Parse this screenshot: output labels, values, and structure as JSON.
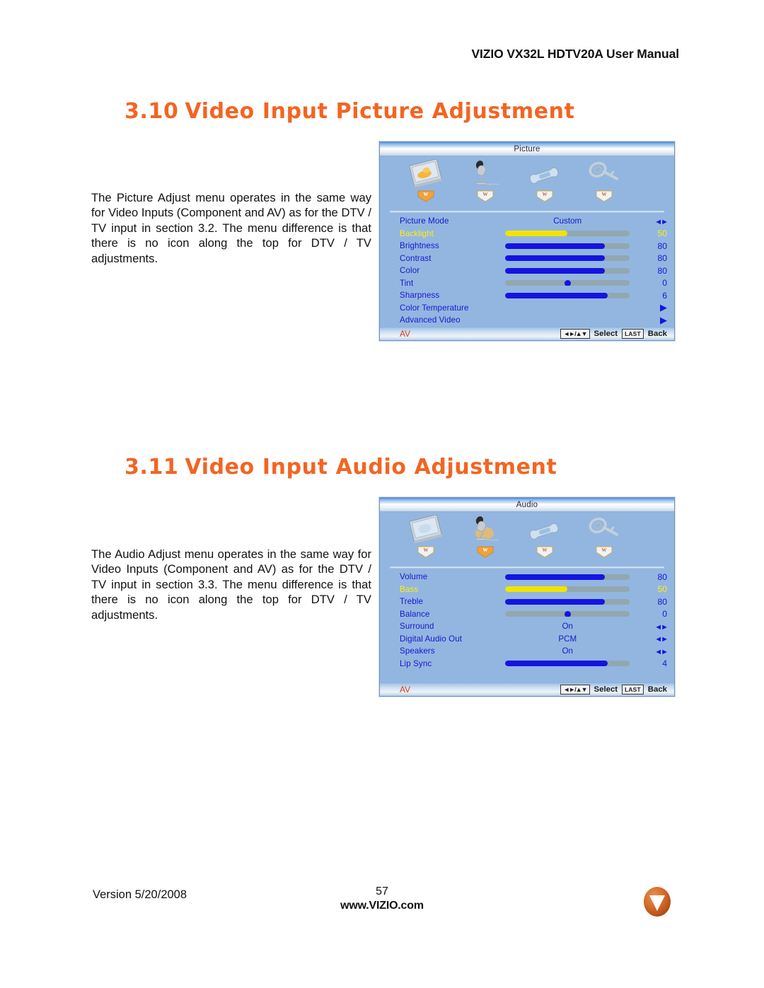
{
  "document": {
    "running_header": "VIZIO VX32L HDTV20A User Manual",
    "footer": {
      "version": "Version 5/20/2008",
      "page_number": "57",
      "website": "www.VIZIO.com",
      "logo_letter": "V",
      "logo_color": "#d4692a"
    }
  },
  "sections": [
    {
      "number": "3.10",
      "title": "Video Input Picture Adjustment",
      "body": "The Picture Adjust menu operates in the same way for Video Inputs (Component and AV) as for the DTV / TV input in section 3.2.  The menu difference is that there is no icon along the top for DTV / TV adjustments."
    },
    {
      "number": "3.11",
      "title": "Video Input Audio Adjustment",
      "body": "The Audio Adjust menu operates in the same way for Video Inputs (Component and AV) as for the DTV / TV input in section 3.3.  The menu difference is that there is no icon along the top for DTV / TV adjustments."
    }
  ],
  "osd_picture": {
    "title": "Picture",
    "icons": [
      {
        "name": "picture-screen-icon",
        "label": "Picture",
        "selected": true
      },
      {
        "name": "microphone-audio-icon",
        "label": "Audio",
        "selected": false
      },
      {
        "name": "wrench-setup-icon",
        "label": "Setup",
        "selected": false
      },
      {
        "name": "key-parental-icon",
        "label": "Parental",
        "selected": false
      }
    ],
    "rows": [
      {
        "label": "Picture Mode",
        "type": "option",
        "value": "Custom",
        "control": "left-right-arrows"
      },
      {
        "label": "Backlight",
        "type": "slider",
        "value": "50",
        "percent": 50,
        "highlighted": true
      },
      {
        "label": "Brightness",
        "type": "slider",
        "value": "80",
        "percent": 80,
        "highlighted": false
      },
      {
        "label": "Contrast",
        "type": "slider",
        "value": "80",
        "percent": 80,
        "highlighted": false
      },
      {
        "label": "Color",
        "type": "slider",
        "value": "80",
        "percent": 80,
        "highlighted": false
      },
      {
        "label": "Tint",
        "type": "centered-slider",
        "value": "0",
        "percent": 50,
        "highlighted": false
      },
      {
        "label": "Sharpness",
        "type": "slider",
        "value": "6",
        "percent": 82,
        "highlighted": false
      },
      {
        "label": "Color Temperature",
        "type": "submenu",
        "value": "",
        "control": "right-arrow"
      },
      {
        "label": "Advanced Video",
        "type": "submenu",
        "value": "",
        "control": "right-arrow"
      }
    ],
    "footer": {
      "input_label": "AV",
      "nav_key": "◄►/▲▼",
      "select_label": "Select",
      "last_key": "LAST",
      "back_label": "Back"
    }
  },
  "osd_audio": {
    "title": "Audio",
    "icons": [
      {
        "name": "picture-screen-icon",
        "label": "Picture",
        "selected": false
      },
      {
        "name": "microphone-audio-icon",
        "label": "Audio",
        "selected": true
      },
      {
        "name": "wrench-setup-icon",
        "label": "Setup",
        "selected": false
      },
      {
        "name": "key-parental-icon",
        "label": "Parental",
        "selected": false
      }
    ],
    "rows": [
      {
        "label": "Volume",
        "type": "slider",
        "value": "80",
        "percent": 80,
        "highlighted": false
      },
      {
        "label": "Bass",
        "type": "slider",
        "value": "50",
        "percent": 50,
        "highlighted": true
      },
      {
        "label": "Treble",
        "type": "slider",
        "value": "80",
        "percent": 80,
        "highlighted": false
      },
      {
        "label": "Balance",
        "type": "centered-slider",
        "value": "0",
        "percent": 50,
        "highlighted": false
      },
      {
        "label": "Surround",
        "type": "option",
        "value": "On",
        "control": "left-right-arrows"
      },
      {
        "label": "Digital Audio Out",
        "type": "option",
        "value": "PCM",
        "control": "left-right-arrows"
      },
      {
        "label": "Speakers",
        "type": "option",
        "value": "On",
        "control": "left-right-arrows"
      },
      {
        "label": "Lip Sync",
        "type": "slider",
        "value": "4",
        "percent": 82,
        "highlighted": false
      }
    ],
    "footer": {
      "input_label": "AV",
      "nav_key": "◄►/▲▼",
      "select_label": "Select",
      "last_key": "LAST",
      "back_label": "Back"
    }
  },
  "colors": {
    "heading_orange": "#f26522",
    "osd_background": "#93b6e0",
    "osd_label_blue": "#1616d2",
    "osd_highlight_yellow": "#ffee11",
    "slider_fill_blue": "#1414e0",
    "slider_fill_yellow": "#f2e300",
    "slider_track_gray": "#93a7b0",
    "input_label_red": "#e23a1c"
  }
}
